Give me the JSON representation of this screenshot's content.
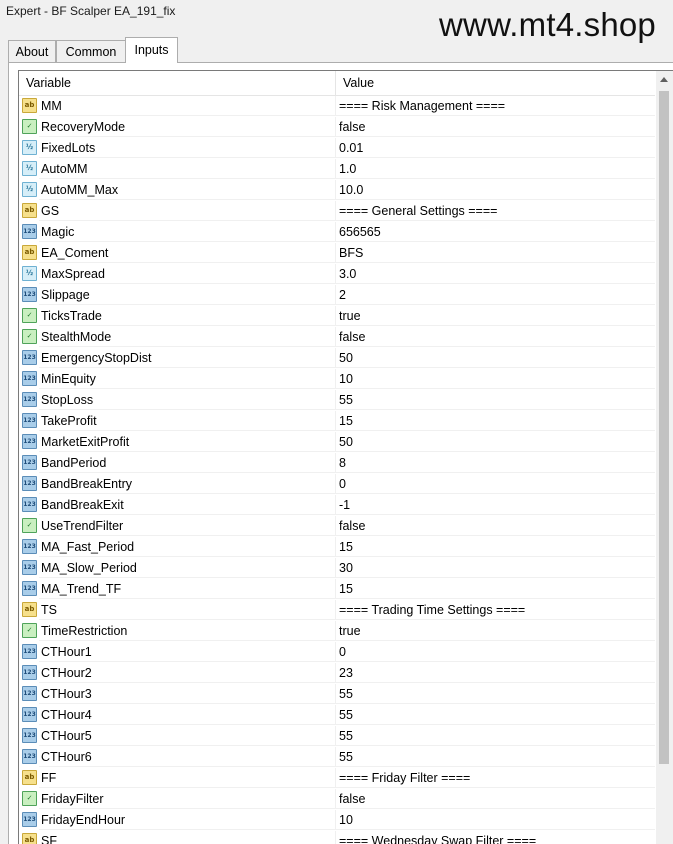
{
  "window": {
    "title": "Expert - BF Scalper EA_191_fix"
  },
  "watermark": "www.mt4.shop",
  "tabs": [
    {
      "label": "About"
    },
    {
      "label": "Common"
    },
    {
      "label": "Inputs"
    }
  ],
  "grid": {
    "headers": {
      "variable": "Variable",
      "value": "Value"
    },
    "rows": [
      {
        "icon": "ab-string-icon",
        "name": "MM",
        "value": "==== Risk Management ===="
      },
      {
        "icon": "bool-icon",
        "name": "RecoveryMode",
        "value": "false"
      },
      {
        "icon": "double-icon",
        "name": "FixedLots",
        "value": "0.01"
      },
      {
        "icon": "double-icon",
        "name": "AutoMM",
        "value": "1.0"
      },
      {
        "icon": "double-icon",
        "name": "AutoMM_Max",
        "value": "10.0"
      },
      {
        "icon": "ab-string-icon",
        "name": "GS",
        "value": "==== General Settings ===="
      },
      {
        "icon": "int-icon",
        "name": "Magic",
        "value": "656565"
      },
      {
        "icon": "ab-string-icon",
        "name": "EA_Coment",
        "value": "BFS"
      },
      {
        "icon": "double-icon",
        "name": "MaxSpread",
        "value": "3.0"
      },
      {
        "icon": "int-icon",
        "name": "Slippage",
        "value": "2"
      },
      {
        "icon": "bool-icon",
        "name": "TicksTrade",
        "value": "true"
      },
      {
        "icon": "bool-icon",
        "name": "StealthMode",
        "value": "false"
      },
      {
        "icon": "int-icon",
        "name": "EmergencyStopDist",
        "value": "50"
      },
      {
        "icon": "int-icon",
        "name": "MinEquity",
        "value": "10"
      },
      {
        "icon": "int-icon",
        "name": "StopLoss",
        "value": "55"
      },
      {
        "icon": "int-icon",
        "name": "TakeProfit",
        "value": "15"
      },
      {
        "icon": "int-icon",
        "name": "MarketExitProfit",
        "value": "50"
      },
      {
        "icon": "int-icon",
        "name": "BandPeriod",
        "value": "8"
      },
      {
        "icon": "int-icon",
        "name": "BandBreakEntry",
        "value": "0"
      },
      {
        "icon": "int-icon",
        "name": "BandBreakExit",
        "value": "-1"
      },
      {
        "icon": "bool-icon",
        "name": "UseTrendFilter",
        "value": "false"
      },
      {
        "icon": "int-icon",
        "name": "MA_Fast_Period",
        "value": "15"
      },
      {
        "icon": "int-icon",
        "name": "MA_Slow_Period",
        "value": "30"
      },
      {
        "icon": "int-icon",
        "name": "MA_Trend_TF",
        "value": "15"
      },
      {
        "icon": "ab-string-icon",
        "name": "TS",
        "value": "==== Trading Time Settings ===="
      },
      {
        "icon": "bool-icon",
        "name": "TimeRestriction",
        "value": "true"
      },
      {
        "icon": "int-icon",
        "name": "CTHour1",
        "value": "0"
      },
      {
        "icon": "int-icon",
        "name": "CTHour2",
        "value": "23"
      },
      {
        "icon": "int-icon",
        "name": "CTHour3",
        "value": "55"
      },
      {
        "icon": "int-icon",
        "name": "CTHour4",
        "value": "55"
      },
      {
        "icon": "int-icon",
        "name": "CTHour5",
        "value": "55"
      },
      {
        "icon": "int-icon",
        "name": "CTHour6",
        "value": "55"
      },
      {
        "icon": "ab-string-icon",
        "name": "FF",
        "value": "==== Friday Filter ===="
      },
      {
        "icon": "bool-icon",
        "name": "FridayFilter",
        "value": "false"
      },
      {
        "icon": "int-icon",
        "name": "FridayEndHour",
        "value": "10"
      },
      {
        "icon": "ab-string-icon",
        "name": "SF",
        "value": "==== Wednesday Swap Filter ===="
      }
    ]
  },
  "icon_glyphs": {
    "ab-string-icon": "ab",
    "int-icon": "123",
    "double-icon": "½",
    "bool-icon": "✓"
  },
  "colors": {
    "window_bg": "#f0f0f0",
    "grid_bg": "#ffffff",
    "grid_line": "#f0f0f0",
    "scroll_thumb": "#c2c2c2"
  }
}
